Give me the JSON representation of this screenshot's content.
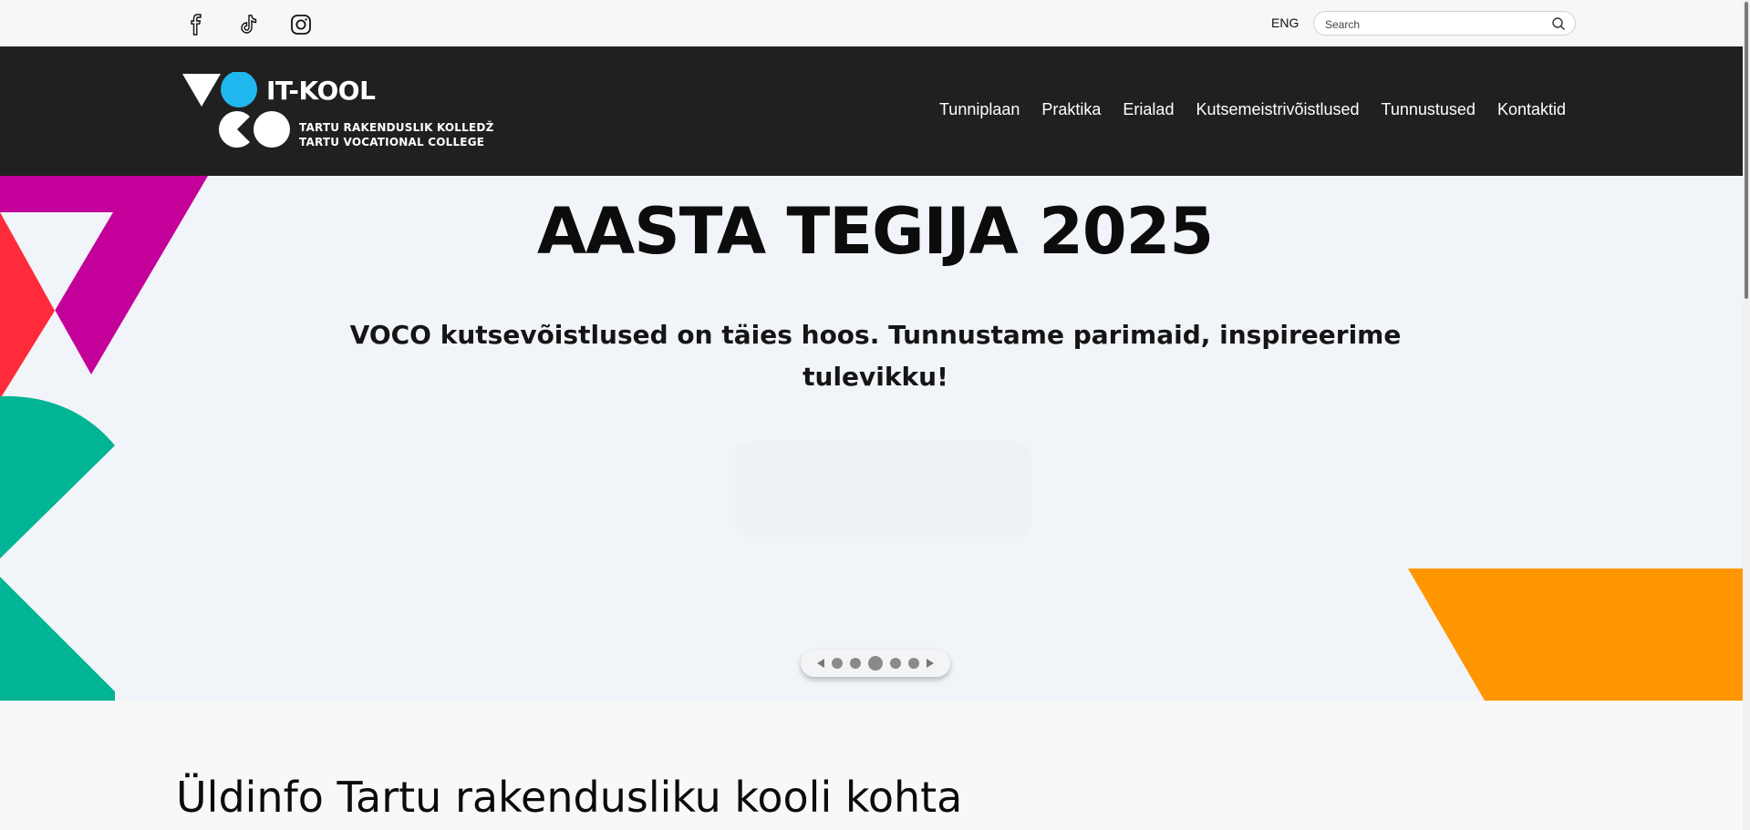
{
  "topbar": {
    "social": [
      {
        "name": "facebook-icon"
      },
      {
        "name": "tiktok-icon"
      },
      {
        "name": "instagram-icon"
      }
    ],
    "lang_label": "ENG",
    "search": {
      "placeholder": "Search",
      "icon": "search-icon"
    }
  },
  "header": {
    "logo": {
      "title": "IT-KOOL",
      "subtitle_line1": "TARTU RAKENDUSLIK KOLLEDŽ",
      "subtitle_line2": "TARTU VOCATIONAL COLLEGE",
      "colors": {
        "accent": "#1fb7ee",
        "mark": "#ffffff"
      }
    },
    "nav": [
      "Tunniplaan",
      "Praktika",
      "Erialad",
      "Kutsemeistrivõistlused",
      "Tunnustused",
      "Kontaktid"
    ],
    "background": "#202020"
  },
  "hero": {
    "title": "AASTA TEGIJA 2025",
    "subtitle": "VOCO kutsevõistlused on täies hoos. Tunnustame parimaid, inspireerime tulevikku!",
    "slides_total": 5,
    "slide_active": 3,
    "colors": {
      "magenta": "#c4009a",
      "red": "#ff2a3a",
      "teal": "#00b494",
      "orange": "#ff9600",
      "background": "#f1f4f8"
    }
  },
  "section": {
    "heading": "Üldinfo Tartu rakendusliku kooli kohta"
  }
}
